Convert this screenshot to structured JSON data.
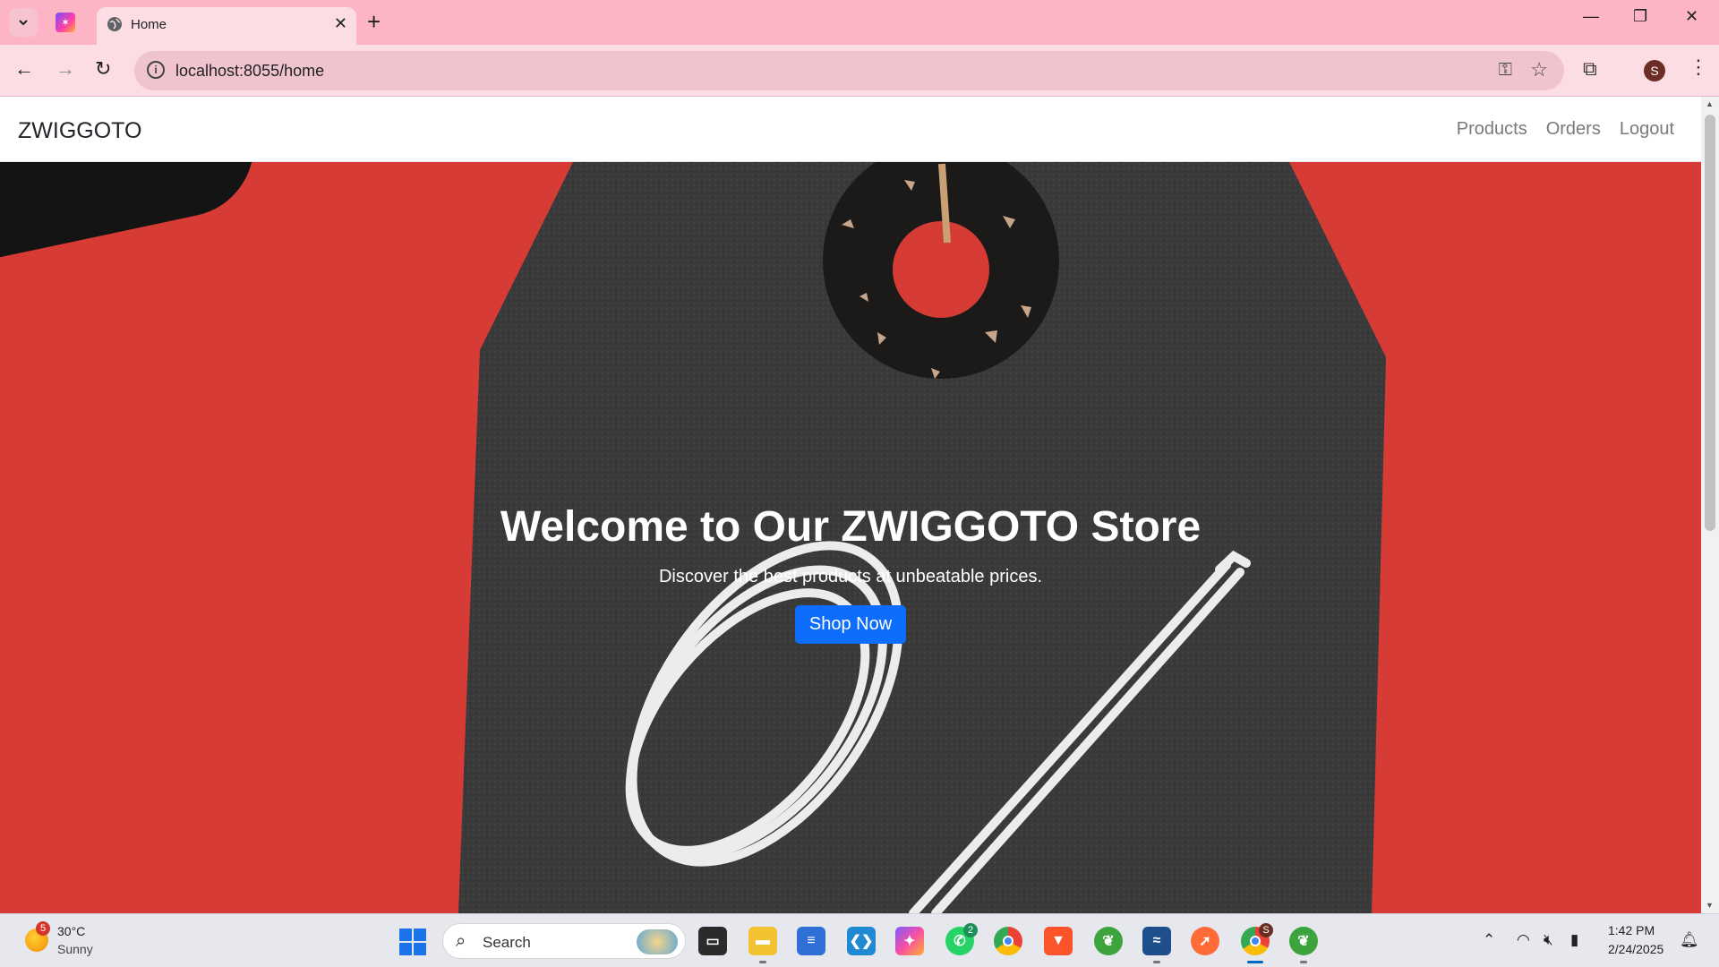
{
  "browser": {
    "tab_title": "Home",
    "url": "localhost:8055/home",
    "profile_initial": "S"
  },
  "navbar": {
    "brand": "ZWIGGOTO",
    "links": [
      {
        "label": "Products"
      },
      {
        "label": "Orders"
      },
      {
        "label": "Logout"
      }
    ]
  },
  "hero": {
    "title": "Welcome to Our ZWIGGOTO Store",
    "subtitle": "Discover the best products at unbeatable prices.",
    "cta_label": "Shop Now"
  },
  "taskbar": {
    "weather": {
      "badge": "5",
      "temperature": "30°C",
      "condition": "Sunny"
    },
    "search_label": "Search",
    "whatsapp_badge": "2",
    "chrome_badge": "S",
    "time": "1:42 PM",
    "date": "2/24/2025"
  },
  "colors": {
    "tabstrip": "#fdb4c4",
    "hero_background": "#d63b35",
    "cta_button": "#0d6efd"
  },
  "icons": [
    "tab-search-icon",
    "globe-icon",
    "close-icon",
    "plus-icon",
    "minimize-icon",
    "restore-icon",
    "back-icon",
    "forward-icon",
    "reload-icon",
    "info-icon",
    "password-key-icon",
    "bookmark-star-icon",
    "extensions-icon",
    "kebab-menu-icon",
    "windows-start-icon",
    "search-icon",
    "wifi-icon",
    "muted-speaker-icon",
    "battery-icon",
    "notification-icon"
  ]
}
